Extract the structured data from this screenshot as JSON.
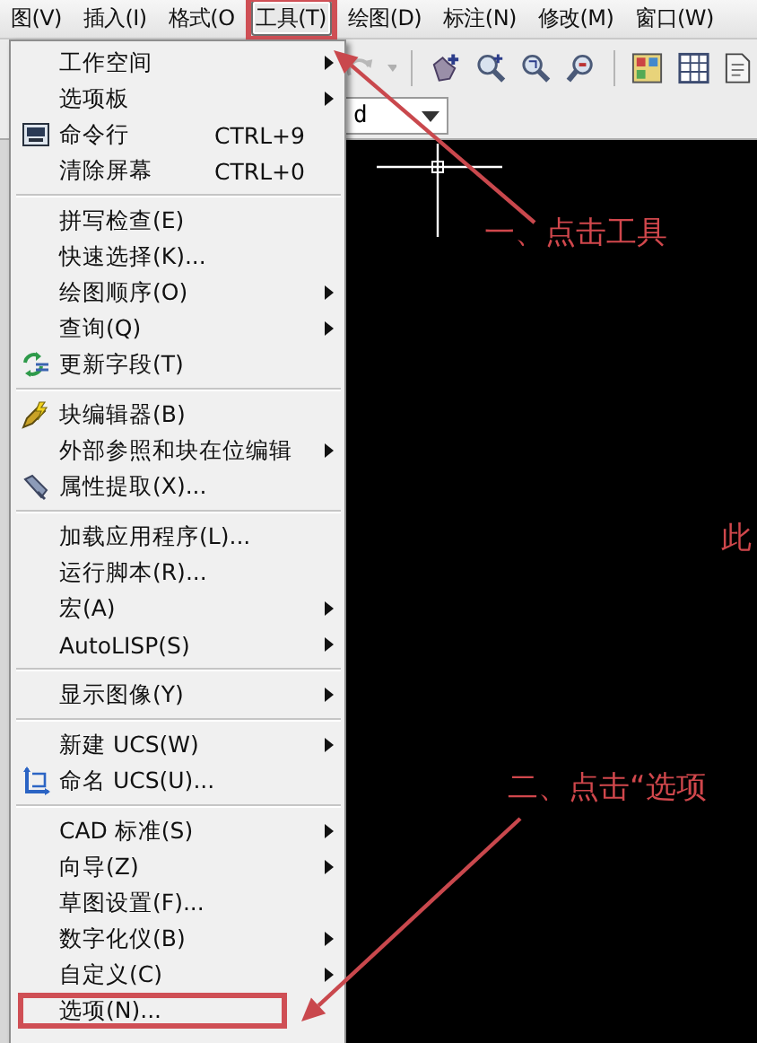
{
  "menubar": [
    {
      "label": "图(V)",
      "selected": false,
      "annotated": false
    },
    {
      "label": "插入(I)",
      "selected": false,
      "annotated": false
    },
    {
      "label": "格式(O",
      "selected": false,
      "annotated": false
    },
    {
      "label": "工具(T)",
      "selected": true,
      "annotated": true
    },
    {
      "label": "绘图(D)",
      "selected": false,
      "annotated": false
    },
    {
      "label": "标注(N)",
      "selected": false,
      "annotated": false
    },
    {
      "label": "修改(M)",
      "selected": false,
      "annotated": false
    },
    {
      "label": "窗口(W)",
      "selected": false,
      "annotated": false
    }
  ],
  "toolbar": {
    "combo_value": "d"
  },
  "tools_menu": {
    "sections": [
      {
        "items": [
          {
            "label": "工作空间",
            "kind": "plain",
            "submenu": true,
            "annotated": false
          },
          {
            "label": "选项板",
            "kind": "plain",
            "submenu": true,
            "annotated": false
          },
          {
            "label": "命令行",
            "kind": "icon",
            "shortcut": "CTRL+9",
            "submenu": false,
            "annotated": false
          },
          {
            "label": "清除屏幕",
            "kind": "plain",
            "shortcut": "CTRL+0",
            "submenu": false,
            "annotated": false
          }
        ]
      },
      {
        "items": [
          {
            "label": "拼写检查(E)",
            "kind": "plain",
            "submenu": false,
            "annotated": false
          },
          {
            "label": "快速选择(K)...",
            "kind": "plain",
            "submenu": false,
            "annotated": false
          },
          {
            "label": "绘图顺序(O)",
            "kind": "plain",
            "submenu": true,
            "annotated": false
          },
          {
            "label": "查询(Q)",
            "kind": "plain",
            "submenu": true,
            "annotated": false
          },
          {
            "label": "更新字段(T)",
            "kind": "icon",
            "submenu": false,
            "annotated": false
          }
        ]
      },
      {
        "items": [
          {
            "label": "块编辑器(B)",
            "kind": "icon",
            "submenu": false,
            "annotated": false
          },
          {
            "label": "外部参照和块在位编辑",
            "kind": "plain",
            "submenu": true,
            "annotated": false
          },
          {
            "label": "属性提取(X)...",
            "kind": "icon",
            "submenu": false,
            "annotated": false
          }
        ]
      },
      {
        "items": [
          {
            "label": "加载应用程序(L)...",
            "kind": "plain",
            "submenu": false,
            "annotated": false
          },
          {
            "label": "运行脚本(R)...",
            "kind": "plain",
            "submenu": false,
            "annotated": false
          },
          {
            "label": "宏(A)",
            "kind": "plain",
            "submenu": true,
            "annotated": false
          },
          {
            "label": "AutoLISP(S)",
            "kind": "plain",
            "submenu": true,
            "annotated": false
          }
        ]
      },
      {
        "items": [
          {
            "label": "显示图像(Y)",
            "kind": "plain",
            "submenu": true,
            "annotated": false
          }
        ]
      },
      {
        "items": [
          {
            "label": "新建 UCS(W)",
            "kind": "plain",
            "submenu": true,
            "annotated": false
          },
          {
            "label": "命名 UCS(U)...",
            "kind": "icon",
            "submenu": false,
            "annotated": false
          }
        ]
      },
      {
        "items": [
          {
            "label": "CAD 标准(S)",
            "kind": "plain",
            "submenu": true,
            "annotated": false
          },
          {
            "label": "向导(Z)",
            "kind": "plain",
            "submenu": true,
            "annotated": false
          },
          {
            "label": "草图设置(F)...",
            "kind": "plain",
            "submenu": false,
            "annotated": false
          },
          {
            "label": "数字化仪(B)",
            "kind": "plain",
            "submenu": true,
            "annotated": false
          },
          {
            "label": "自定义(C)",
            "kind": "plain",
            "submenu": true,
            "annotated": false
          },
          {
            "label": "选项(N)...",
            "kind": "plain",
            "submenu": false,
            "annotated": true
          }
        ]
      }
    ]
  },
  "drawing_area": {
    "annotations": [
      {
        "text": "一、点击工具",
        "arrow": true
      },
      {
        "text": "此",
        "arrow": false
      },
      {
        "text": "二、点击“选项",
        "arrow": true
      }
    ]
  }
}
